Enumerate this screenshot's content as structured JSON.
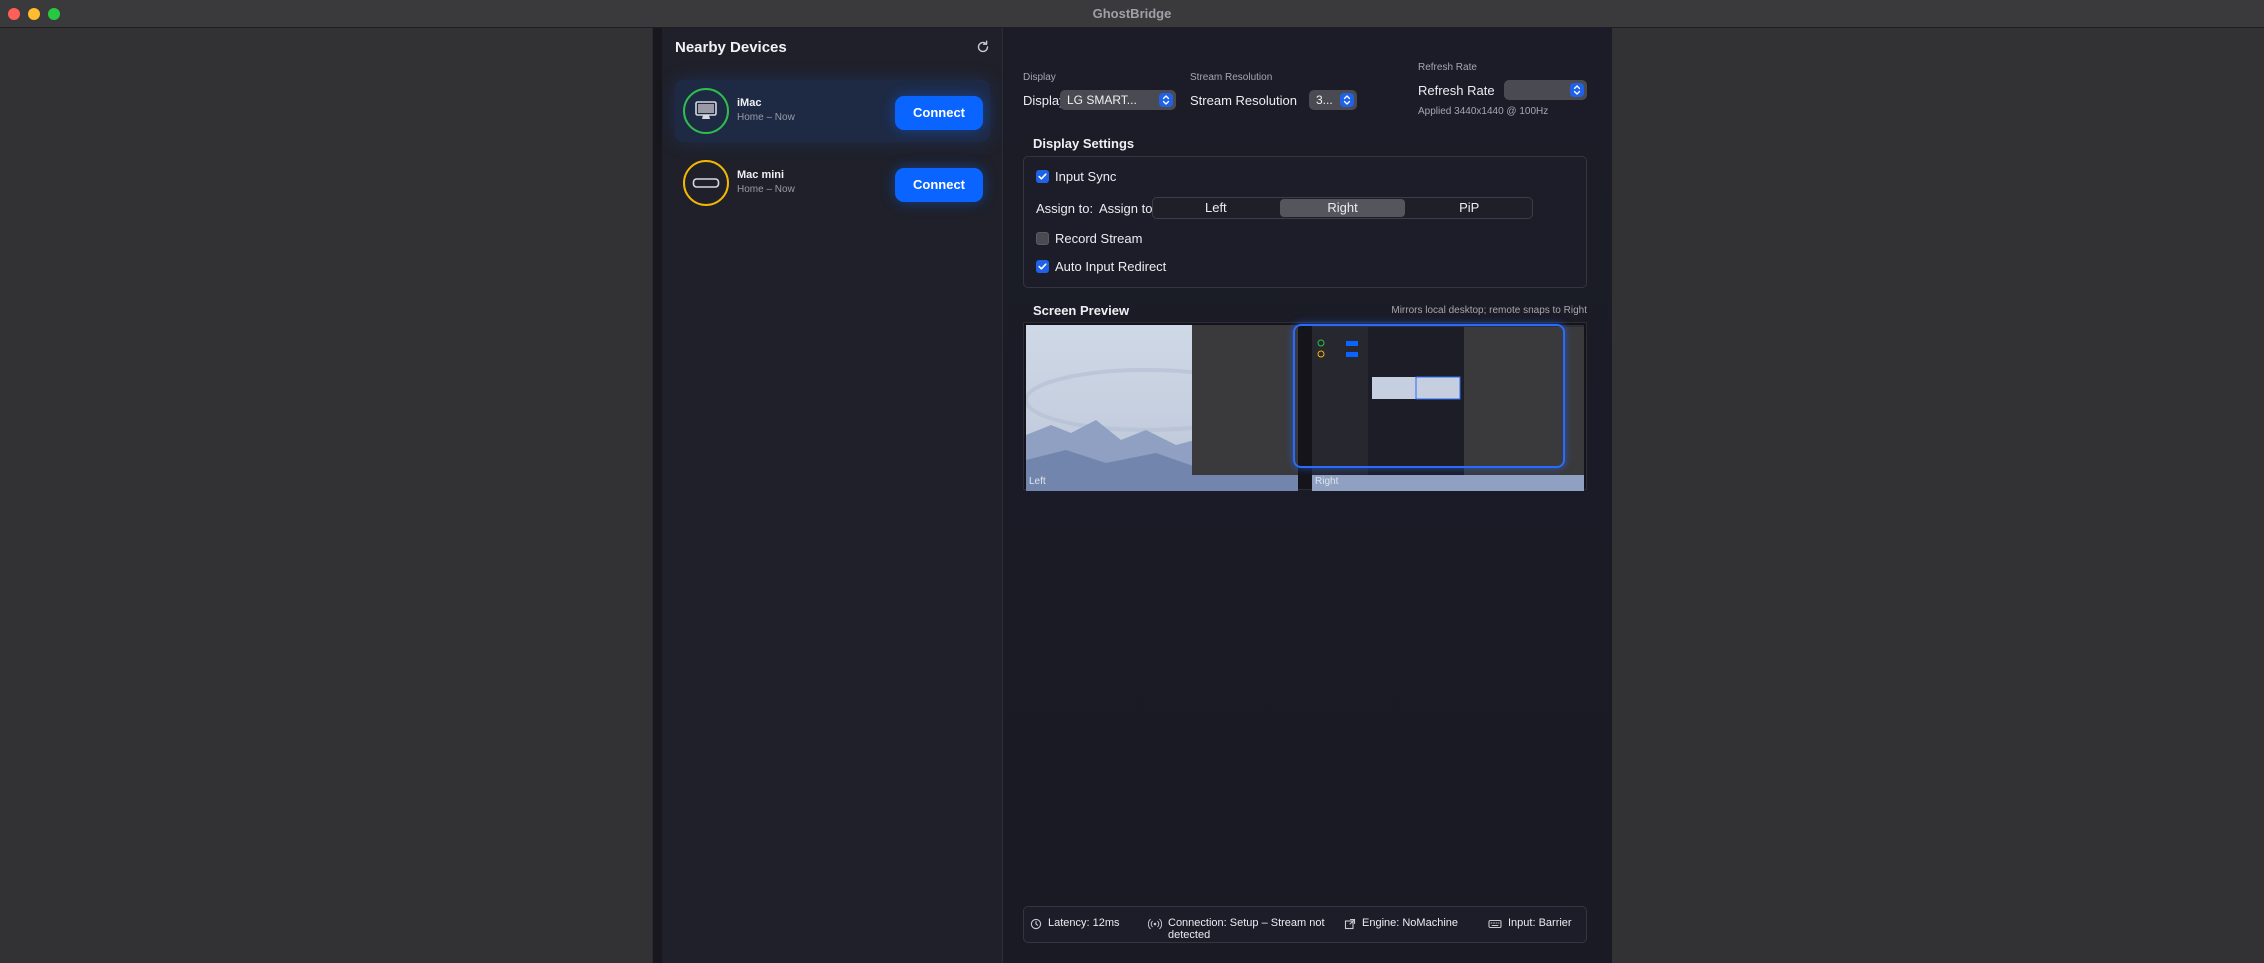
{
  "window": {
    "title": "GhostBridge"
  },
  "sidebar": {
    "title": "Nearby Devices",
    "devices": [
      {
        "name": "iMac",
        "subtitle": "Home – Now",
        "button": "Connect",
        "ring_color": "#2fbd4d"
      },
      {
        "name": "Mac mini",
        "subtitle": "Home – Now",
        "button": "Connect",
        "ring_color": "#f2b705"
      }
    ]
  },
  "toolbar": {
    "display": {
      "caption": "Display",
      "label": "Display",
      "value": "LG SMART..."
    },
    "resolution": {
      "caption": "Stream Resolution",
      "label": "Stream Resolution",
      "value": "3..."
    },
    "refresh": {
      "caption": "Refresh Rate",
      "label": "Refresh Rate",
      "value": "",
      "applied": "Applied 3440x1440 @ 100Hz"
    }
  },
  "settings": {
    "title": "Display Settings",
    "input_sync": {
      "label": "Input Sync",
      "checked": true
    },
    "assign_label_1": "Assign to:",
    "assign_label_2": "Assign to",
    "assign_options": [
      "Left",
      "Right",
      "PiP"
    ],
    "assign_selected": "Right",
    "record_stream": {
      "label": "Record Stream",
      "checked": false
    },
    "auto_redirect": {
      "label": "Auto Input Redirect",
      "checked": true
    }
  },
  "preview": {
    "title": "Screen Preview",
    "note": "Mirrors local desktop; remote snaps to Right",
    "left_label": "Left",
    "right_label": "Right"
  },
  "status": {
    "latency": "Latency: 12ms",
    "connection": "Connection: Setup – Stream not detected",
    "engine": "Engine: NoMachine",
    "input": "Input: Barrier"
  },
  "colors": {
    "accent": "#0a64ff",
    "check": "#1f62e8"
  }
}
